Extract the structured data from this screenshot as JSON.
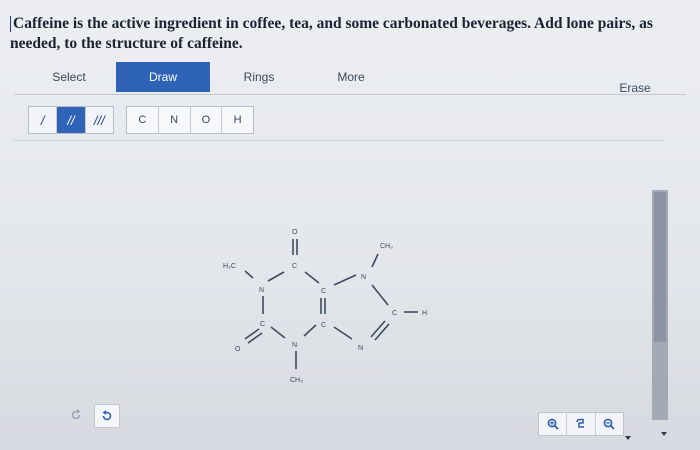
{
  "question": {
    "text": "Caffeine is the active ingredient in coffee, tea, and some carbonated beverages. Add lone pairs, as needed, to the structure of caffeine."
  },
  "toolbar": {
    "tabs": [
      {
        "label": "Select",
        "active": false
      },
      {
        "label": "Draw",
        "active": true
      },
      {
        "label": "Rings",
        "active": false
      },
      {
        "label": "More",
        "active": false
      },
      {
        "label": "Erase",
        "active": false
      }
    ]
  },
  "tools": {
    "bonds": [
      {
        "label": "/",
        "name": "single-bond",
        "active": false
      },
      {
        "label": "//",
        "name": "double-bond",
        "active": true
      },
      {
        "label": "///",
        "name": "triple-bond",
        "active": false
      }
    ],
    "atoms": [
      "C",
      "N",
      "O",
      "H"
    ]
  },
  "molecule": {
    "atoms": {
      "o_top": "O",
      "c_top": "C",
      "h3c": "H₃C",
      "n_left": "N",
      "c_mid1": "C",
      "c_mid2": "C",
      "c_bottom": "C",
      "o_left": "O",
      "n_bottom": "N",
      "ch3_bottom": "CH₃",
      "n_right_top": "N",
      "ch3_top": "CH₃",
      "c_right": "C",
      "h_right": "H",
      "n_right_bottom": "N"
    }
  },
  "bottom": {
    "undo_icon": "undo-icon",
    "redo_icon": "redo-icon",
    "zoom_in_icon": "zoom-in-icon",
    "reset_icon": "reset-icon",
    "zoom_out_icon": "zoom-out-icon"
  },
  "colors": {
    "accent": "#2f63b8",
    "structure": "#3e4b5f"
  }
}
